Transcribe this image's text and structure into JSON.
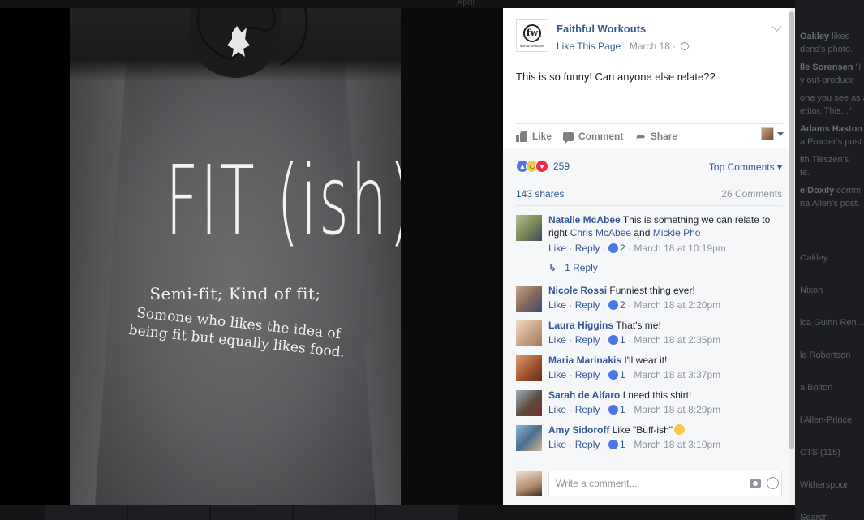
{
  "background": {
    "top_strip_text": "April",
    "ticker": [
      {
        "name": "Oakley",
        "text": " likes"
      },
      {
        "name": "",
        "text": "dens's photo."
      },
      {
        "name": "lle Sorensen",
        "text": " \"I"
      },
      {
        "name": "",
        "text": "y out-produce"
      },
      {
        "name": "",
        "text": "one you see as a"
      },
      {
        "name": "",
        "text": "etitor. This...\""
      },
      {
        "name": "Adams Haston",
        "text": " l"
      },
      {
        "name": "",
        "text": "a Procter's post."
      },
      {
        "name": "",
        "text": "ith Tieszen's"
      },
      {
        "name": "",
        "text": "te."
      },
      {
        "name": "e Doxily",
        "text": " comm"
      },
      {
        "name": "",
        "text": "na Allen's post."
      }
    ],
    "chat_names": [
      "Oakley",
      "Nixon",
      "ica Guinn Ren...",
      "la Robertson",
      "a Bolton",
      "l Allen-Prince",
      "CTS (115)",
      "Witherspoon",
      "Search"
    ]
  },
  "photo": {
    "shirt_title": "FIT (ish)",
    "shirt_line2": "Semi-fit; Kind of fit;",
    "shirt_line3a": "Somone who likes the idea of",
    "shirt_line3b": "being fit but equally likes food."
  },
  "post": {
    "page_name": "Faithful Workouts",
    "logo_letter": "fw",
    "logo_caption": "faithful workouts",
    "like_page": "Like This Page",
    "dot": " · ",
    "date": "March 18",
    "text": "This is so funny! Can anyone else relate??",
    "actions": {
      "like": "Like",
      "comment": "Comment",
      "share": "Share"
    },
    "reactions_count": "259",
    "top_comments": "Top Comments",
    "shares": "143 shares",
    "comments_count": "26 Comments"
  },
  "comments": [
    {
      "author": "Natalie McAbee",
      "text": "This is something we can relate to right ",
      "tag1": "Chris McAbee",
      "and": " and ",
      "tag2": "Mickie Pho",
      "like": "Like",
      "reply": "Reply",
      "reacts": "2",
      "time": "March 18 at 10:19pm",
      "replies": "1 Reply",
      "avatar_color": "#7d8a5a"
    },
    {
      "author": "Nicole Rossi",
      "text": "Funniest thing ever!",
      "like": "Like",
      "reply": "Reply",
      "reacts": "2",
      "time": "March 18 at 2:20pm",
      "avatar_color": "#8a6a5c"
    },
    {
      "author": "Laura Higgins",
      "text": "That's me!",
      "like": "Like",
      "reply": "Reply",
      "reacts": "1",
      "time": "March 18 at 2:35pm",
      "avatar_color": "#c9a07f"
    },
    {
      "author": "Maria Marinakis",
      "text": "I'll wear it!",
      "like": "Like",
      "reply": "Reply",
      "reacts": "1",
      "time": "March 18 at 3:37pm",
      "avatar_color": "#a0522d"
    },
    {
      "author": "Sarah de Alfaro",
      "text": "I need this shirt!",
      "like": "Like",
      "reply": "Reply",
      "reacts": "1",
      "time": "March 18 at 8:29pm",
      "avatar_color": "#5a4a3a"
    },
    {
      "author": "Amy Sidoroff",
      "text": "Like \"Buff-ish\"",
      "like": "Like",
      "reply": "Reply",
      "reacts": "1",
      "time": "March 18 at 3:10pm",
      "avatar_color": "#4a6f8f"
    }
  ],
  "composer": {
    "placeholder": "Write a comment..."
  }
}
